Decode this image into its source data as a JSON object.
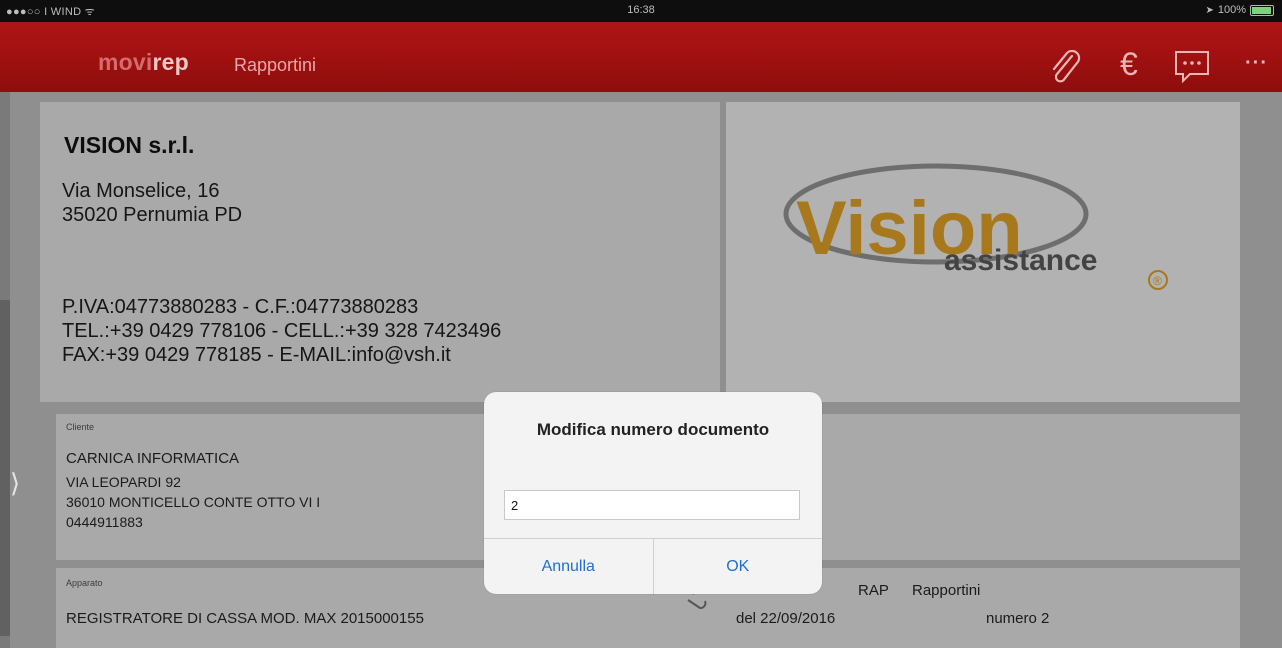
{
  "status_bar": {
    "carrier": "●●●○○ I WIND ᯤ",
    "time": "16:38",
    "battery": "100%"
  },
  "nav": {
    "brand_part1": "movi",
    "brand_part2": "rep",
    "title": "Rapportini",
    "icons": [
      "paperclip-icon",
      "euro-icon",
      "chat-icon",
      "more-icon"
    ],
    "more_symbol": "···",
    "euro_symbol": "€"
  },
  "company": {
    "name": "VISION s.r.l.",
    "address1": "Via Monselice, 16",
    "address2": "35020 Pernumia PD",
    "piva": "P.IVA:04773880283 - C.F.:04773880283",
    "tel": "TEL.:+39 0429 778106 - CELL.:+39 328 7423496",
    "fax": "FAX:+39 0429 778185 - E-MAIL:info@vsh.it"
  },
  "logo": {
    "main": "Vision",
    "sub": "assistance",
    "reg": "®"
  },
  "client": {
    "label": "Cliente",
    "name": "CARNICA  INFORMATICA",
    "street": "VIA LEOPARDI 92",
    "city": "36010  MONTICELLO CONTE OTTO  VI  I",
    "phone": "0444911883"
  },
  "apparato": {
    "label": "Apparato",
    "value": "REGISTRATORE DI CASSA MOD. MAX  2015000155"
  },
  "document": {
    "type_code": "RAP",
    "type_name": "Rapportini",
    "date": "del 22/09/2016",
    "number": "numero 2"
  },
  "dialog": {
    "title": "Modifica numero documento",
    "input_value": "2",
    "cancel_label": "Annulla",
    "ok_label": "OK"
  },
  "colors": {
    "nav_red": "#a01010",
    "link_blue": "#1e6fd4",
    "logo_gold": "#b8860b"
  }
}
